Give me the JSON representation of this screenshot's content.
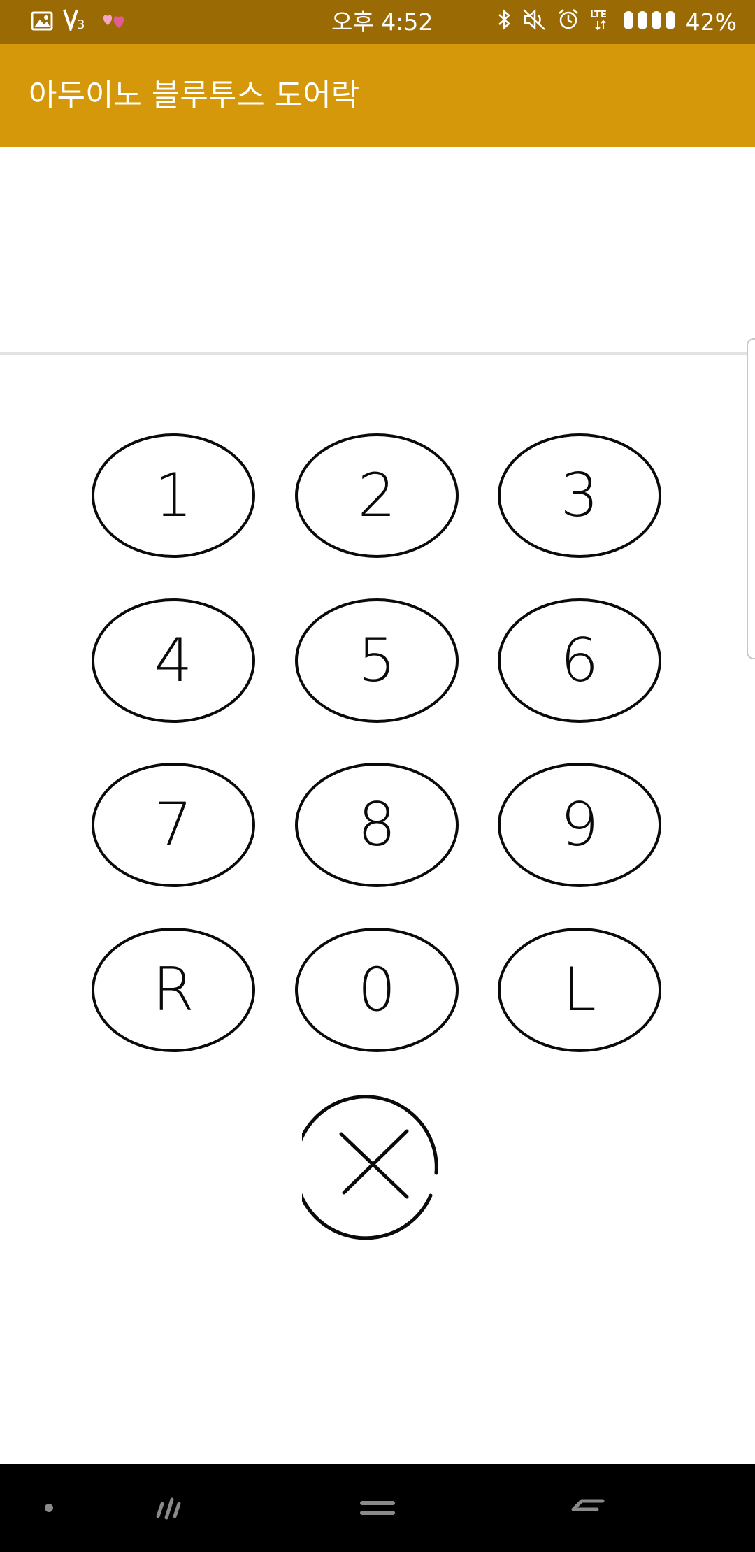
{
  "status_bar": {
    "time": "오후 4:52",
    "battery": "42%",
    "network": "LTE",
    "left_icons": [
      "gallery-icon",
      "v3-icon",
      "hearts-icon"
    ],
    "right_icons": [
      "bluetooth-icon",
      "mute-icon",
      "alarm-icon",
      "lte-icon",
      "signal-icon"
    ]
  },
  "app_bar": {
    "title": "아두이노 블루투스 도어락",
    "color": "#d4980a",
    "status_color": "#9a6a04"
  },
  "display": {
    "value": ""
  },
  "keypad": {
    "keys": [
      {
        "label": "1"
      },
      {
        "label": "2"
      },
      {
        "label": "3"
      },
      {
        "label": "4"
      },
      {
        "label": "5"
      },
      {
        "label": "6"
      },
      {
        "label": "7"
      },
      {
        "label": "8"
      },
      {
        "label": "9"
      },
      {
        "label": "R"
      },
      {
        "label": "0"
      },
      {
        "label": "L"
      }
    ],
    "clear_icon": "clear-x-icon"
  },
  "nav_bar": {
    "icons": [
      "dot-icon",
      "recent-apps-icon",
      "home-icon",
      "back-icon"
    ]
  }
}
